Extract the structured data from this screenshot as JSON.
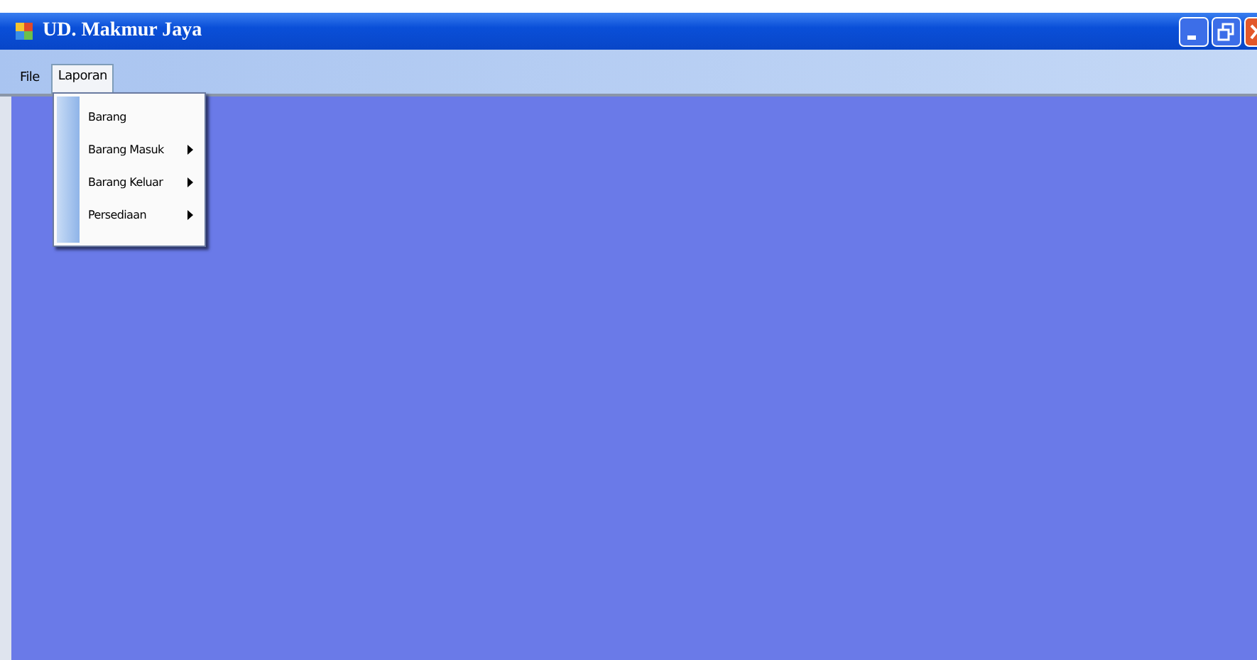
{
  "window": {
    "title": "UD. Makmur Jaya"
  },
  "menu_bar": [
    {
      "label": "File",
      "selected": false
    },
    {
      "label": "Laporan",
      "selected": true
    }
  ],
  "dropdown": [
    {
      "label": "Barang",
      "has_submenu": false
    },
    {
      "label": "Barang Masuk",
      "has_submenu": true
    },
    {
      "label": "Barang Keluar",
      "has_submenu": true
    },
    {
      "label": "Persediaan",
      "has_submenu": true
    }
  ]
}
